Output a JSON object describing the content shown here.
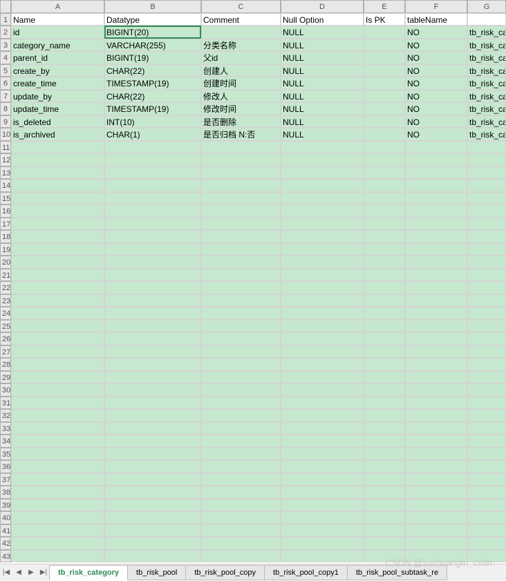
{
  "columns": [
    "A",
    "B",
    "C",
    "D",
    "E",
    "F",
    "G"
  ],
  "headers": {
    "A": "Name",
    "B": "Datatype",
    "C": "Comment",
    "D": "Null Option",
    "E": "Is PK",
    "F": "tableName",
    "G": ""
  },
  "rows": [
    {
      "A": "id",
      "B": "BIGINT(20)",
      "C": "",
      "D": "NULL",
      "E": "",
      "F": "NO",
      "G": "tb_risk_category"
    },
    {
      "A": "category_name",
      "B": "VARCHAR(255)",
      "C": "分类名称",
      "D": "NULL",
      "E": "",
      "F": "NO",
      "G": "tb_risk_category"
    },
    {
      "A": "parent_id",
      "B": "BIGINT(19)",
      "C": "父id",
      "D": "NULL",
      "E": "",
      "F": "NO",
      "G": "tb_risk_category"
    },
    {
      "A": "create_by",
      "B": "CHAR(22)",
      "C": "创建人",
      "D": "NULL",
      "E": "",
      "F": "NO",
      "G": "tb_risk_category"
    },
    {
      "A": "create_time",
      "B": "TIMESTAMP(19)",
      "C": "创建时间",
      "D": "NULL",
      "E": "",
      "F": "NO",
      "G": "tb_risk_category"
    },
    {
      "A": "update_by",
      "B": "CHAR(22)",
      "C": "修改人",
      "D": "NULL",
      "E": "",
      "F": "NO",
      "G": "tb_risk_category"
    },
    {
      "A": "update_time",
      "B": "TIMESTAMP(19)",
      "C": "修改时间",
      "D": "NULL",
      "E": "",
      "F": "NO",
      "G": "tb_risk_category"
    },
    {
      "A": "is_deleted",
      "B": "INT(10)",
      "C": "是否删除",
      "D": "NULL",
      "E": "",
      "F": "NO",
      "G": "tb_risk_category"
    },
    {
      "A": "is_archived",
      "B": "CHAR(1)",
      "C": "是否归档  N:否",
      "D": "NULL",
      "E": "",
      "F": "NO",
      "G": "tb_risk_category"
    }
  ],
  "selected_cell": "B2",
  "empty_rows_count": 33,
  "tabs": {
    "nav": [
      "|◀",
      "◀",
      "▶",
      "▶|"
    ],
    "items": [
      "tb_risk_category",
      "tb_risk_pool",
      "tb_risk_pool_copy",
      "tb_risk_pool_copy1",
      "tb_risk_pool_subtask_re"
    ],
    "active_index": 0
  },
  "watermark": "CSDN @xushuanglu_csdn"
}
